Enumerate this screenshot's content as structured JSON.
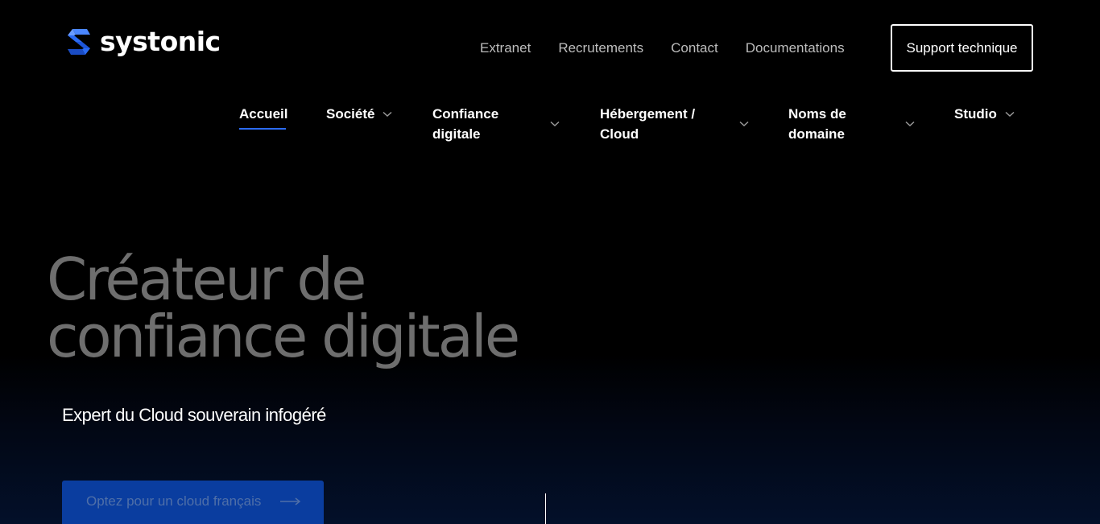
{
  "brand": {
    "name": "systonic",
    "accent": "#2b6bf3"
  },
  "top_links": [
    "Extranet",
    "Recrutements",
    "Contact",
    "Documentations"
  ],
  "support_label": "Support technique",
  "nav": {
    "items": [
      {
        "line1": "Accueil",
        "line2": "",
        "dropdown": false,
        "active": true
      },
      {
        "line1": "Société",
        "line2": "",
        "dropdown": true
      },
      {
        "line1": "Confiance",
        "line2": "digitale",
        "dropdown": true
      },
      {
        "line1": "Hébergement /",
        "line2": "Cloud",
        "dropdown": true
      },
      {
        "line1": "Noms de",
        "line2": "domaine",
        "dropdown": true
      },
      {
        "line1": "Studio",
        "line2": "",
        "dropdown": true
      }
    ]
  },
  "hero": {
    "title_line1": "Créateur de",
    "title_line2": "confiance digitale",
    "subtitle": "Expert du Cloud souverain infogéré",
    "cta_label": "Optez pour un cloud français"
  }
}
